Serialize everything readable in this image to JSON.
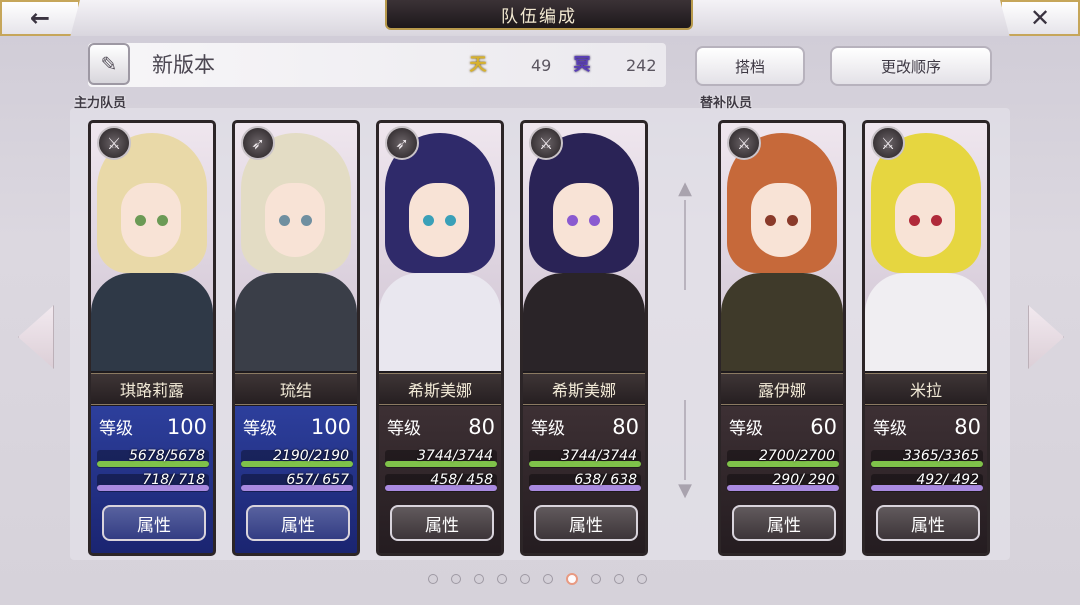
{
  "header": {
    "back_icon": "←",
    "close_icon": "✕",
    "title": "队伍编成"
  },
  "team": {
    "name": "新版本",
    "pen_icon": "✎",
    "sky_icon_text": "天",
    "sky_value": "49",
    "underworld_icon_text": "冥",
    "underworld_value": "242",
    "partner_button": "搭档",
    "reorder_button": "更改顺序"
  },
  "sections": {
    "main_label": "主力队员",
    "reserve_label": "替补队员"
  },
  "colors": {
    "blue_stats_bg": "#2d3f9c",
    "dark_stats_bg": "#3d3034",
    "hp_bar": "#7fc24a",
    "sp_bar": "#a98ae0",
    "gold_border": "#b89a4c"
  },
  "cards": [
    {
      "name": "琪路莉露",
      "level_label": "等级",
      "level": "100",
      "hp": "5678/5678",
      "sp": "718/ 718",
      "attr_label": "属性",
      "type_icon": "sword-icon",
      "stats_theme": "blue",
      "hair": "#e9d9a8",
      "eye": "#6b9a55",
      "outfit": "#2f3947"
    },
    {
      "name": "琉结",
      "level_label": "等级",
      "level": "100",
      "hp": "2190/2190",
      "sp": "657/ 657",
      "attr_label": "属性",
      "type_icon": "spear-icon",
      "stats_theme": "blue",
      "hair": "#e3dcc4",
      "eye": "#6f8fa0",
      "outfit": "#3a3e48"
    },
    {
      "name": "希斯美娜",
      "level_label": "等级",
      "level": "80",
      "hp": "3744/3744",
      "sp": "458/ 458",
      "attr_label": "属性",
      "type_icon": "spear-icon",
      "stats_theme": "dark",
      "hair": "#2f2a6a",
      "eye": "#3aa0b8",
      "outfit": "#e9e7ef"
    },
    {
      "name": "希斯美娜",
      "level_label": "等级",
      "level": "80",
      "hp": "3744/3744",
      "sp": "638/ 638",
      "attr_label": "属性",
      "type_icon": "sword-icon",
      "stats_theme": "dark",
      "hair": "#2a2356",
      "eye": "#8a5ad0",
      "outfit": "#2a2428"
    },
    {
      "name": "露伊娜",
      "level_label": "等级",
      "level": "60",
      "hp": "2700/2700",
      "sp": "290/ 290",
      "attr_label": "属性",
      "type_icon": "sword-icon",
      "stats_theme": "dark",
      "hair": "#c6693a",
      "eye": "#8a3a2a",
      "outfit": "#3f3a2a"
    },
    {
      "name": "米拉",
      "level_label": "等级",
      "level": "80",
      "hp": "3365/3365",
      "sp": "492/ 492",
      "attr_label": "属性",
      "type_icon": "sword-icon",
      "stats_theme": "dark",
      "hair": "#e6d640",
      "eye": "#b02a3a",
      "outfit": "#f0eef2"
    }
  ],
  "pagination": {
    "total": 10,
    "active_index": 6
  }
}
